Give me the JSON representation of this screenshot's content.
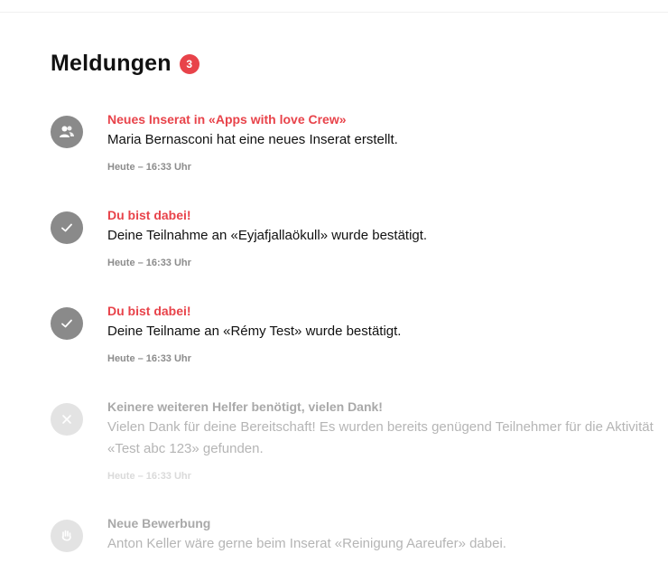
{
  "header": {
    "title": "Meldungen",
    "unread_count": "3"
  },
  "notifications": [
    {
      "icon": "users-icon",
      "headline": "Neues Inserat in «Apps with love Crew»",
      "message": "Maria Bernasconi hat eine neues Inserat erstellt.",
      "time": "Heute – 16:33 Uhr",
      "read": false
    },
    {
      "icon": "check-icon",
      "headline": "Du bist dabei!",
      "message": "Deine Teilnahme an «Eyjafjallaökull» wurde bestätigt.",
      "time": "Heute – 16:33 Uhr",
      "read": false
    },
    {
      "icon": "check-icon",
      "headline": "Du bist dabei!",
      "message": "Deine Teilname an «Rémy Test» wurde bestätigt.",
      "time": "Heute – 16:33 Uhr",
      "read": false
    },
    {
      "icon": "close-icon",
      "headline": "Keinere weiteren Helfer benötigt, vielen Dank!",
      "message": "Vielen Dank für deine Bereitschaft! Es wurden bereits genügend Teilnehmer für die Aktivität «Test abc 123» gefunden.",
      "time": "Heute – 16:33 Uhr",
      "read": true
    },
    {
      "icon": "hand-icon",
      "headline": "Neue Bewerbung",
      "message": "Anton Keller wäre gerne beim Inserat «Reinigung Aareufer» dabei.",
      "read": true
    }
  ],
  "colors": {
    "accent": "#e8434a",
    "icon_active": "#8a8a8a",
    "icon_muted": "#e3e3e3"
  }
}
